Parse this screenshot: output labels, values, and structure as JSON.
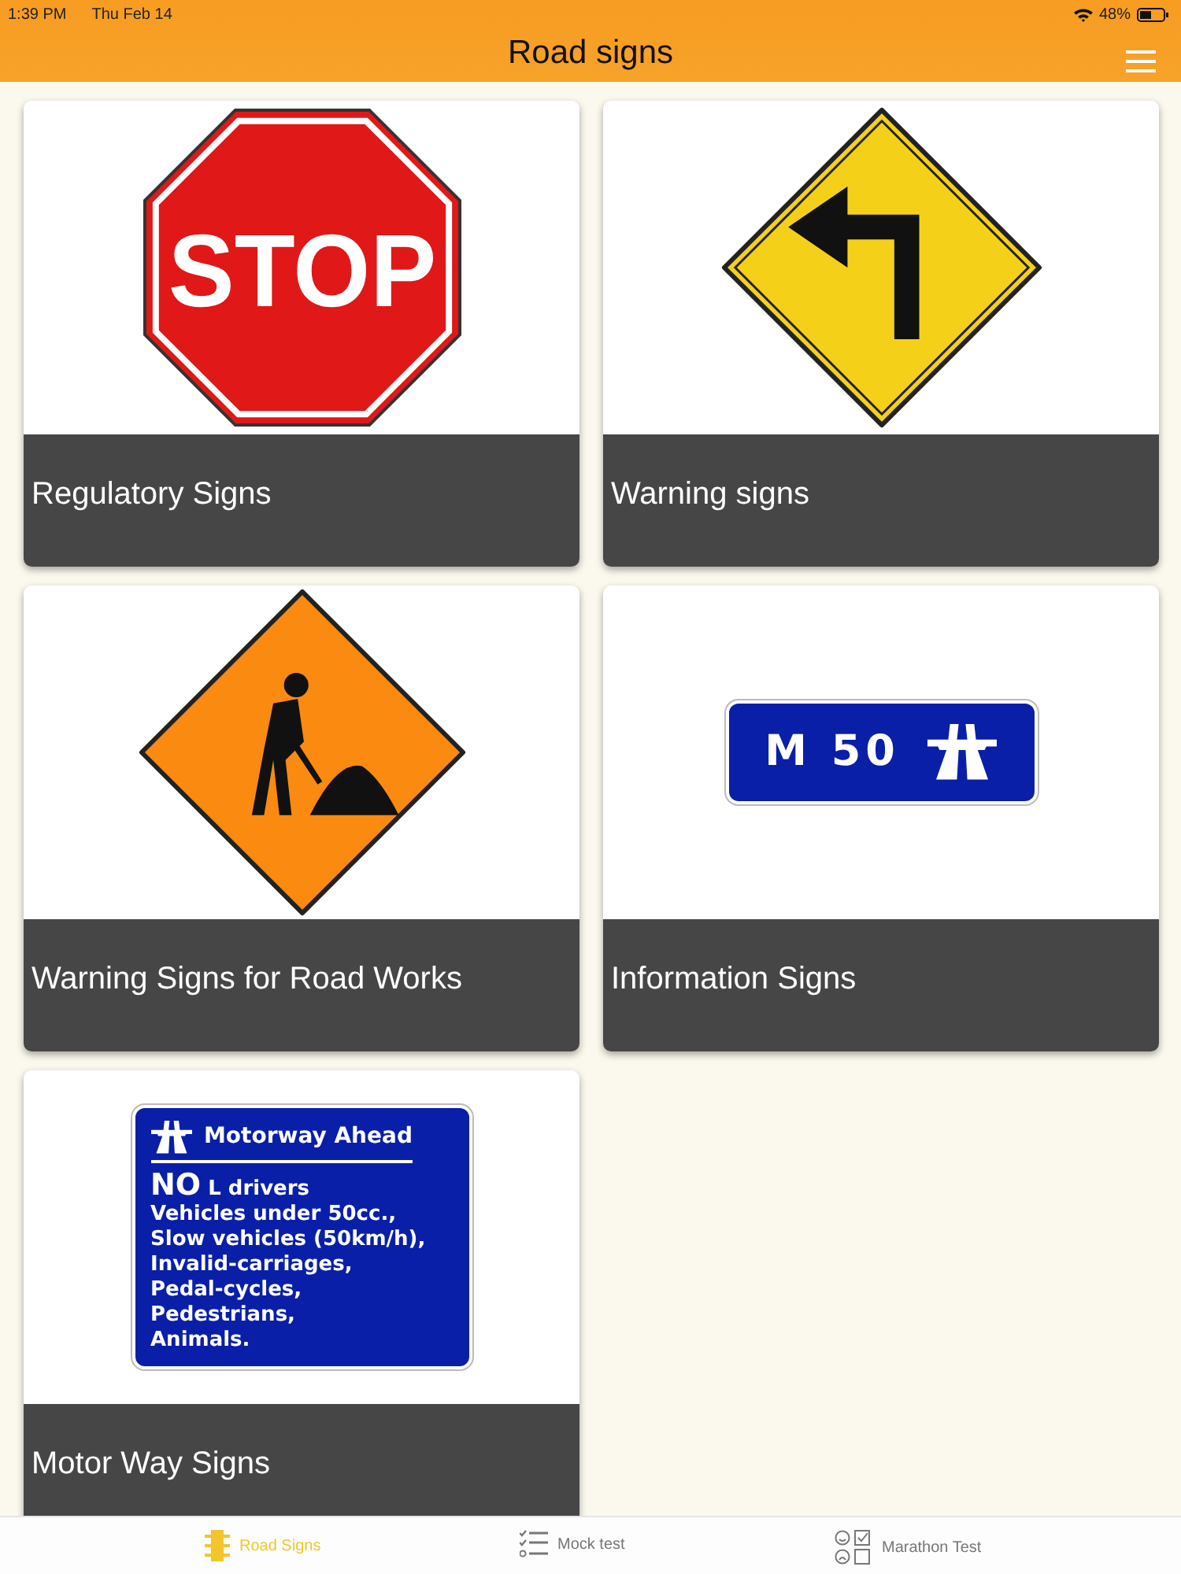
{
  "status_bar": {
    "time": "1:39 PM",
    "date": "Thu Feb 14",
    "battery": "48%"
  },
  "header": {
    "title": "Road signs"
  },
  "cards": [
    {
      "caption": "Regulatory Signs",
      "sign": {
        "kind": "stop",
        "lines": [
          "STOP"
        ]
      }
    },
    {
      "caption": "Warning signs",
      "sign": {
        "kind": "turn"
      }
    },
    {
      "caption": "Warning Signs for Road Works",
      "sign": {
        "kind": "roadworks"
      }
    },
    {
      "caption": "Information Signs",
      "sign": {
        "kind": "route",
        "lines": [
          "M 50"
        ]
      }
    },
    {
      "caption": "Motor Way Signs",
      "sign": {
        "kind": "motorway",
        "title": "Motorway Ahead",
        "lines": [
          "**NO** L drivers",
          "Vehicles under 50cc.,",
          "Slow vehicles (50km/h),",
          "Invalid-carriages,",
          "Pedal-cycles,",
          "Pedestrians,",
          "Animals."
        ]
      }
    }
  ],
  "tabs": [
    {
      "label": "Road Signs",
      "kind": "traffic",
      "selected": true
    },
    {
      "label": "Mock test",
      "kind": "list",
      "selected": false
    },
    {
      "label": "Marathon Test",
      "kind": "marathon",
      "selected": false
    }
  ]
}
